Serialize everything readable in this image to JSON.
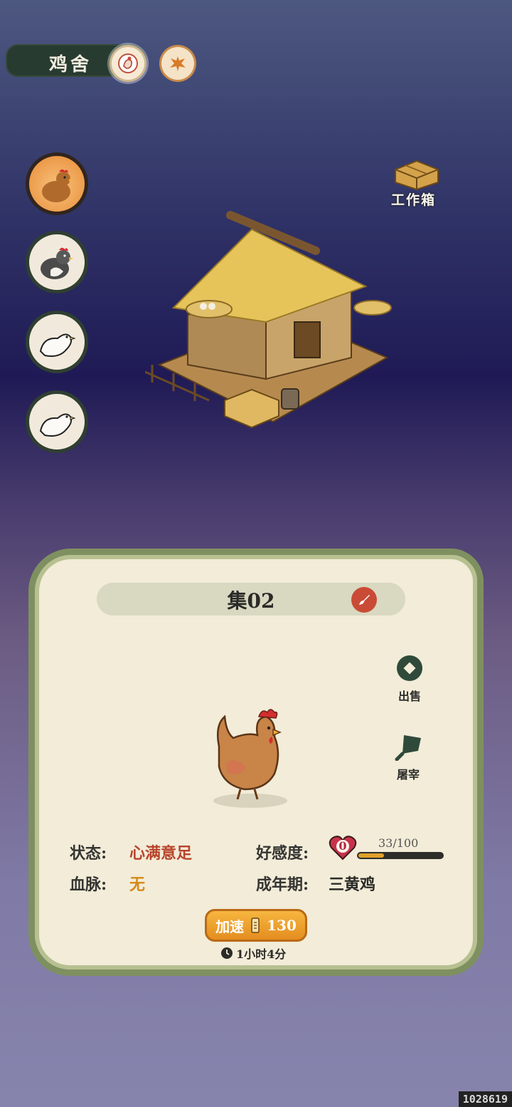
{
  "header": {
    "title": "鸡舍",
    "icons": [
      "chicken-badge-icon",
      "phoenix-badge-icon"
    ]
  },
  "avatars": [
    {
      "name": "brown-hen",
      "active": true
    },
    {
      "name": "black-rooster",
      "active": false
    },
    {
      "name": "white-chick-1",
      "active": false
    },
    {
      "name": "white-chick-2",
      "active": false
    }
  ],
  "workbox": {
    "label": "工作箱"
  },
  "panel": {
    "name": "集02",
    "actions": {
      "sell": "出售",
      "slaughter": "屠宰"
    },
    "stats": {
      "status_label": "状态:",
      "status_value": "心满意足",
      "bloodline_label": "血脉:",
      "bloodline_value": "无",
      "favor_label": "好感度:",
      "favor_heart_value": "0",
      "favor_progress": "33/100",
      "favor_fraction": 0.33,
      "stage_label": "成年期:",
      "stage_value": "三黄鸡"
    },
    "speed": {
      "label": "加速",
      "cost": "130",
      "timer": "1小时4分"
    }
  },
  "colors": {
    "accent_red": "#b8442b",
    "accent_orange": "#d68a19",
    "panel_border": "#7f9060"
  },
  "footer": {
    "id": "1028619"
  }
}
